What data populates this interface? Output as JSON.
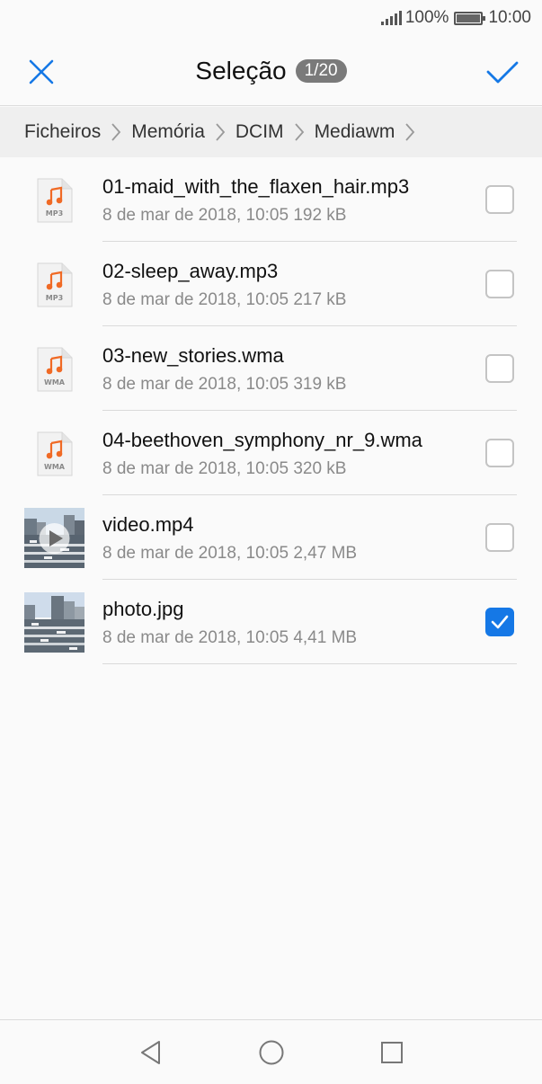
{
  "status_bar": {
    "battery": "100%",
    "time": "10:00"
  },
  "app_bar": {
    "title": "Seleção",
    "count": "1/20"
  },
  "breadcrumb": [
    "Ficheiros",
    "Memória",
    "DCIM",
    "Mediawm"
  ],
  "files": [
    {
      "name": "01-maid_with_the_flaxen_hair.mp3",
      "meta": "8 de mar de 2018, 10:05 192 kB",
      "type": "audio",
      "ext": "MP3",
      "checked": false
    },
    {
      "name": "02-sleep_away.mp3",
      "meta": "8 de mar de 2018, 10:05 217 kB",
      "type": "audio",
      "ext": "MP3",
      "checked": false
    },
    {
      "name": "03-new_stories.wma",
      "meta": "8 de mar de 2018, 10:05 319 kB",
      "type": "audio",
      "ext": "WMA",
      "checked": false
    },
    {
      "name": "04-beethoven_symphony_nr_9.wma",
      "meta": "8 de mar de 2018, 10:05 320 kB",
      "type": "audio",
      "ext": "WMA",
      "checked": false
    },
    {
      "name": "video.mp4",
      "meta": "8 de mar de 2018, 10:05 2,47 MB",
      "type": "video",
      "ext": "",
      "checked": false
    },
    {
      "name": "photo.jpg",
      "meta": "8 de mar de 2018, 10:05 4,41 MB",
      "type": "photo",
      "ext": "",
      "checked": true
    }
  ],
  "colors": {
    "accent": "#1578e6",
    "audio_icon": "#f06a25"
  },
  "icons": {
    "close": "close-icon",
    "confirm": "checkmark-icon",
    "breadcrumb_separator": "chevron-right-icon",
    "nav_back": "triangle-back-icon",
    "nav_home": "circle-home-icon",
    "nav_recents": "square-recents-icon"
  }
}
